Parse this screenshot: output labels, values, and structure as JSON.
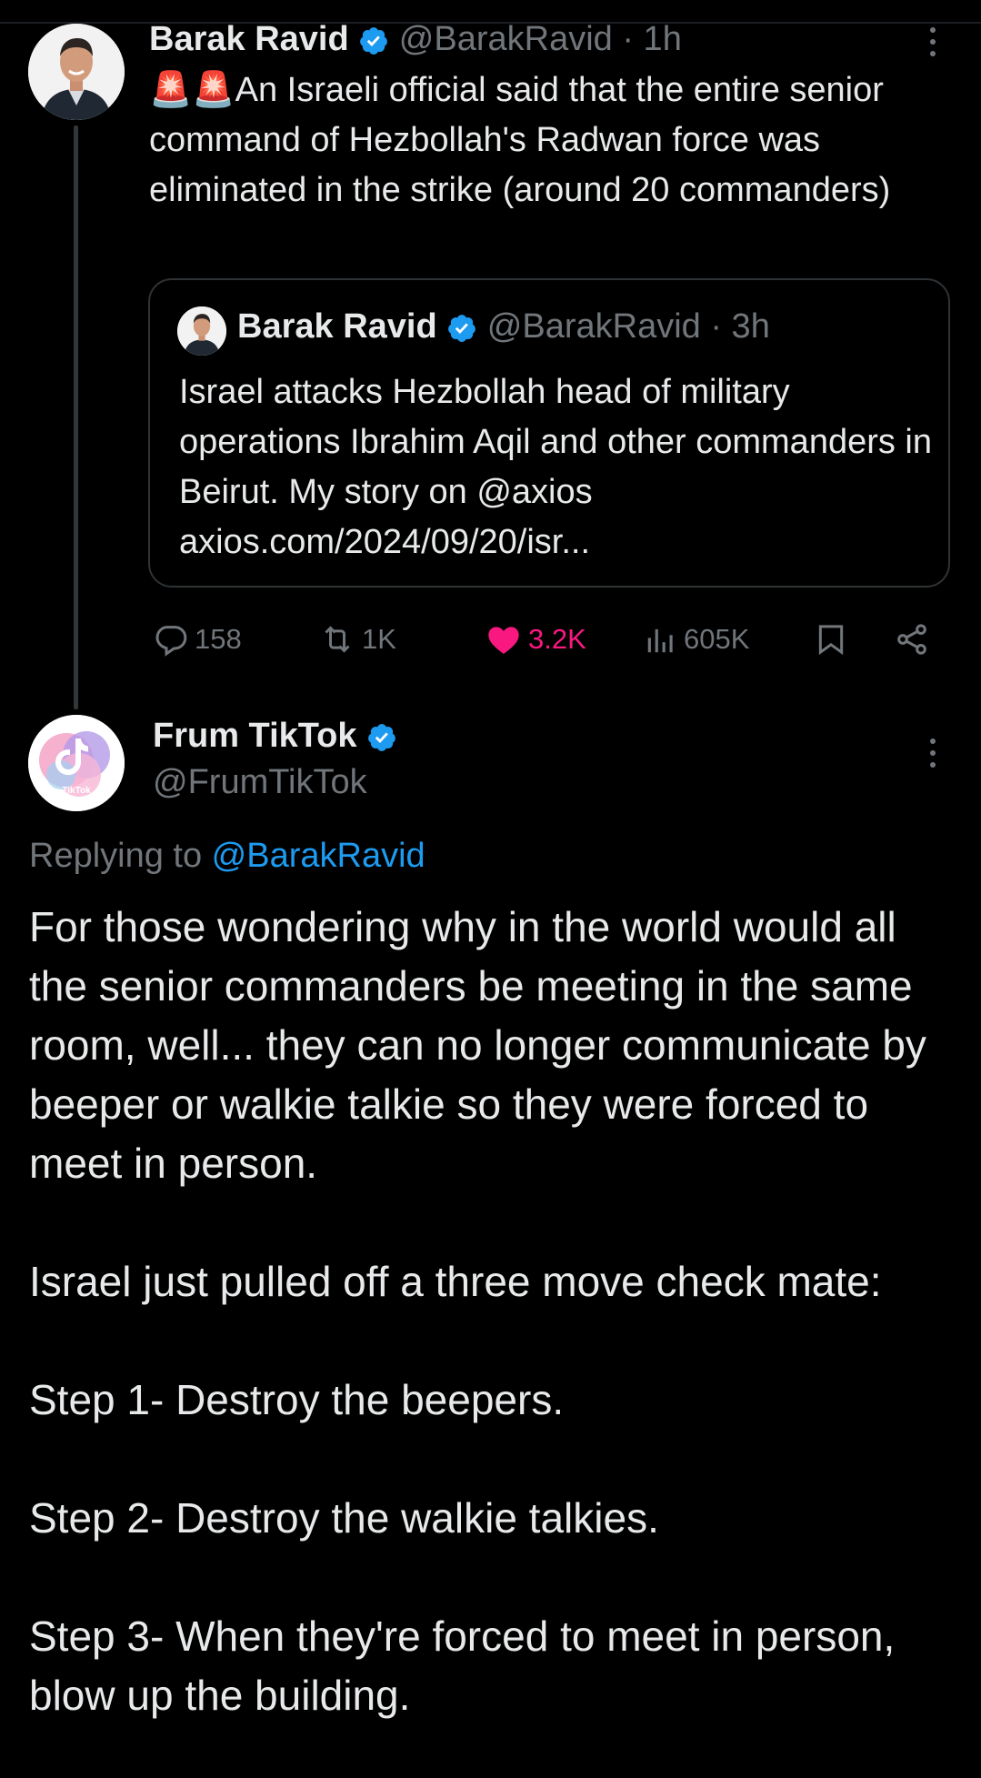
{
  "colors": {
    "background": "#000000",
    "text": "#e7e9ea",
    "muted": "#71767b",
    "link": "#1d9bf0",
    "like_active": "#f91880",
    "verified": "#1d9bf0"
  },
  "tweet": {
    "author_name": "Barak Ravid",
    "handle_time": "@BarakRavid · 1h",
    "emoji": "🚨🚨",
    "text": "An Israeli official said that the entire senior command of Hezbollah's Radwan force was eliminated in the strike (around 20 commanders)",
    "more_icon": "more-vertical-icon",
    "quote": {
      "author_name": "Barak Ravid",
      "handle_time": "@BarakRavid · 3h",
      "text": "Israel attacks Hezbollah head of military operations Ibrahim Aqil and other commanders in Beirut. My story on @axios\naxios.com/2024/09/20/isr..."
    },
    "stats": {
      "replies": "158",
      "reposts": "1K",
      "likes": "3.2K",
      "views": "605K"
    }
  },
  "reply_tweet": {
    "author_name": "Frum TikTok",
    "handle": "@FrumTikTok",
    "replying_prefix": "Replying to ",
    "replying_to": "@BarakRavid",
    "avatar_label": "TikTok",
    "paragraphs": [
      "For those wondering why in the world would all the senior commanders be meeting in the same room, well... they can no longer communicate by beeper or walkie talkie so they were forced to meet in person.",
      "Israel just pulled off a three move check mate:",
      "Step 1- Destroy the beepers.",
      "Step 2- Destroy the walkie talkies.",
      "Step 3- When they're forced to meet in person, blow up the building."
    ]
  }
}
